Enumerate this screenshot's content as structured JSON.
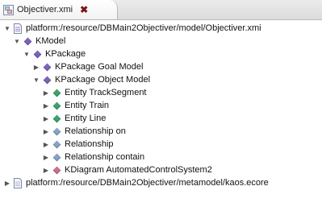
{
  "tab": {
    "title": "Objectiver.xmi",
    "icon": "xmi-resource-icon",
    "close_icon": "close-icon"
  },
  "tree": [
    {
      "label": "platform:/resource/DBMain2Objectiver/model/Objectiver.xmi",
      "depth": 0,
      "expanded": true,
      "icon": "resource-file-icon",
      "color": "#6a7fa8"
    },
    {
      "label": "KModel",
      "depth": 1,
      "expanded": true,
      "icon": "diamond-icon",
      "color": "#7d63b8"
    },
    {
      "label": "KPackage",
      "depth": 2,
      "expanded": true,
      "icon": "diamond-icon",
      "color": "#7d63b8"
    },
    {
      "label": "KPackage Goal Model",
      "depth": 3,
      "expanded": false,
      "icon": "diamond-icon",
      "color": "#7d63b8"
    },
    {
      "label": "KPackage Object Model",
      "depth": 3,
      "expanded": true,
      "icon": "diamond-icon",
      "color": "#7d63b8"
    },
    {
      "label": "Entity TrackSegment",
      "depth": 4,
      "expanded": false,
      "icon": "diamond-icon",
      "color": "#3da36a"
    },
    {
      "label": "Entity Train",
      "depth": 4,
      "expanded": false,
      "icon": "diamond-icon",
      "color": "#3da36a"
    },
    {
      "label": "Entity Line",
      "depth": 4,
      "expanded": false,
      "icon": "diamond-icon",
      "color": "#3da36a"
    },
    {
      "label": "Relationship on",
      "depth": 4,
      "expanded": false,
      "icon": "diamond-icon",
      "color": "#8aa2c8"
    },
    {
      "label": "Relationship",
      "depth": 4,
      "expanded": false,
      "icon": "diamond-icon",
      "color": "#8aa2c8"
    },
    {
      "label": "Relationship contain",
      "depth": 4,
      "expanded": false,
      "icon": "diamond-icon",
      "color": "#8aa2c8"
    },
    {
      "label": "KDiagram AutomatedControlSystem2",
      "depth": 4,
      "expanded": false,
      "icon": "diamond-icon",
      "color": "#c9708e"
    },
    {
      "label": "platform:/resource/DBMain2Objectiver/metamodel/kaos.ecore",
      "depth": 0,
      "expanded": false,
      "icon": "ecore-file-icon",
      "color": "#6a7fa8"
    }
  ]
}
